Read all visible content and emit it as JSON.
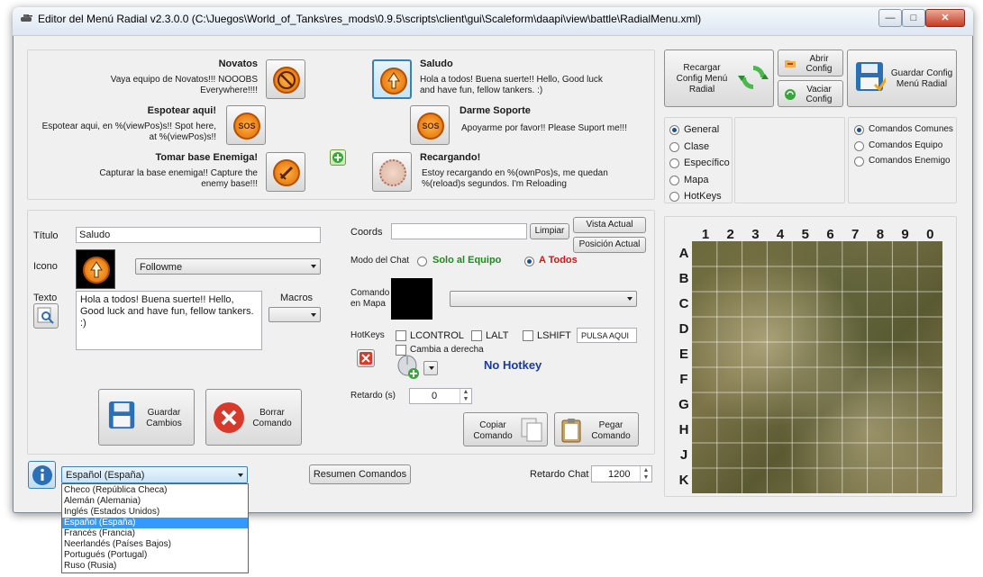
{
  "window": {
    "title": "Editor del Menú Radial v2.3.0.0 (C:\\Juegos\\World_of_Tanks\\res_mods\\0.9.5\\scripts\\client\\gui\\Scaleform\\daapi\\view\\battle\\RadialMenu.xml)",
    "minimize": "—",
    "maximize": "□",
    "close": "✕"
  },
  "commands": [
    {
      "title": "Novatos",
      "desc": "Vaya equipo de Novatos!!! NOOOBS Everywhere!!!!",
      "icon": "no-entry-icon"
    },
    {
      "title": "Saludo",
      "desc": "Hola a todos! Buena suerte!! Hello, Good luck and have fun, fellow tankers. :)",
      "icon": "flame-arrow-icon"
    },
    {
      "title": "Espotear aqui!",
      "desc": "Espotear aqui, en %(viewPos)s!! Spot here, at %(viewPos)s!!",
      "icon": "sos-icon"
    },
    {
      "title": "Darme Soporte",
      "desc": "Apoyarme por favor!! Please Suport me!!!",
      "icon": "sos-icon"
    },
    {
      "title": "Tomar base Enemiga!",
      "desc": "Capturar la base enemiga!! Capture the enemy base!!!",
      "icon": "sword-icon"
    },
    {
      "title": "Recargando!",
      "desc": "Estoy recargando en %(ownPos)s, me quedan %(reload)s segundos.  I'm Reloading",
      "icon": "reload-dots-icon"
    }
  ],
  "toolbar": {
    "reload": "Recargar Config Menú Radial",
    "open": "Abrir Config",
    "empty": "Vaciar Config",
    "save": "Guardar Config Menú Radial"
  },
  "categories": {
    "left": [
      "General",
      "Clase",
      "Específico",
      "Mapa",
      "HotKeys"
    ],
    "left_selected": 0,
    "right": [
      "Comandos Comunes",
      "Comandos Equipo",
      "Comandos Enemigo"
    ],
    "right_selected": 0
  },
  "editor": {
    "title_label": "Título",
    "title_value": "Saludo",
    "icon_label": "Icono",
    "icon_value": "Followme",
    "text_label": "Texto",
    "text_value": "Hola a todos! Buena suerte!! Hello, Good luck and have fun, fellow tankers. :)",
    "macros_label": "Macros",
    "save_btn": "Guardar Cambios",
    "delete_btn": "Borrar Comando"
  },
  "coords": {
    "label": "Coords",
    "value": "",
    "clear": "Limpiar",
    "current_view": "Vista Actual",
    "current_pos": "Posición Actual",
    "chat_mode_label": "Modo del Chat",
    "chat_team": "Solo al Equipo",
    "chat_all": "A Todos",
    "chat_selected": "all",
    "map_cmd_label": "Comando en Mapa",
    "hotkeys_label": "HotKeys",
    "lcontrol": "LCONTROL",
    "lalt": "LALT",
    "lshift": "LSHIFT",
    "key_input": "PULSA AQUI",
    "swap_right": "Cambia a derecha",
    "no_hotkey": "No Hotkey",
    "delay_label": "Retardo (s)",
    "delay_value": "0",
    "copy_btn": "Copiar Comando",
    "paste_btn": "Pegar Comando"
  },
  "footer": {
    "language": "Español (España)",
    "summary_btn": "Resumen Comandos",
    "chat_delay_label": "Retardo Chat",
    "chat_delay_value": "1200"
  },
  "languages": [
    "Checo (República Checa)",
    "Alemán (Alemania)",
    "Inglés (Estados Unidos)",
    "Español (España)",
    "Francés (Francia)",
    "Neerlandés (Países Bajos)",
    "Portugués (Portugal)",
    "Ruso (Rusia)"
  ],
  "languages_selected": 3,
  "map": {
    "columns": [
      "1",
      "2",
      "3",
      "4",
      "5",
      "6",
      "7",
      "8",
      "9",
      "0"
    ],
    "rows": [
      "A",
      "B",
      "C",
      "D",
      "E",
      "F",
      "G",
      "H",
      "J",
      "K"
    ]
  },
  "colors": {
    "accent": "#3c7fb1",
    "chat_team": "#1f8a1f",
    "chat_all": "#d01515",
    "no_hotkey": "#1d3a9a"
  }
}
